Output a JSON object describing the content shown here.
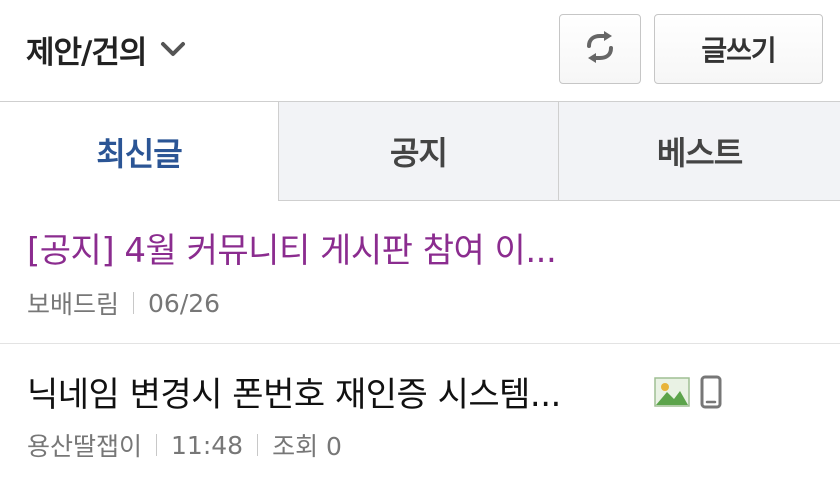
{
  "header": {
    "board_title": "제안/건의",
    "write_label": "글쓰기",
    "icons": [
      "chevron-down-icon",
      "refresh-icon"
    ]
  },
  "tabs": [
    {
      "label": "최신글",
      "active": true
    },
    {
      "label": "공지",
      "active": false
    },
    {
      "label": "베스트",
      "active": false
    }
  ],
  "posts": [
    {
      "title": "[공지] 4월 커뮤니티 게시판 참여 이...",
      "author": "보배드림",
      "date": "06/26"
    },
    {
      "title": "닉네임 변경시 폰번호 재인증 시스템...",
      "author": "용산딸잽이",
      "time": "11:48",
      "views": "조회 0",
      "icons": [
        "image-icon",
        "mobile-icon"
      ]
    }
  ],
  "colors": {
    "active_tab": "#2b5595",
    "notice_title": "#8b2c8f",
    "meta_text": "#777777"
  }
}
